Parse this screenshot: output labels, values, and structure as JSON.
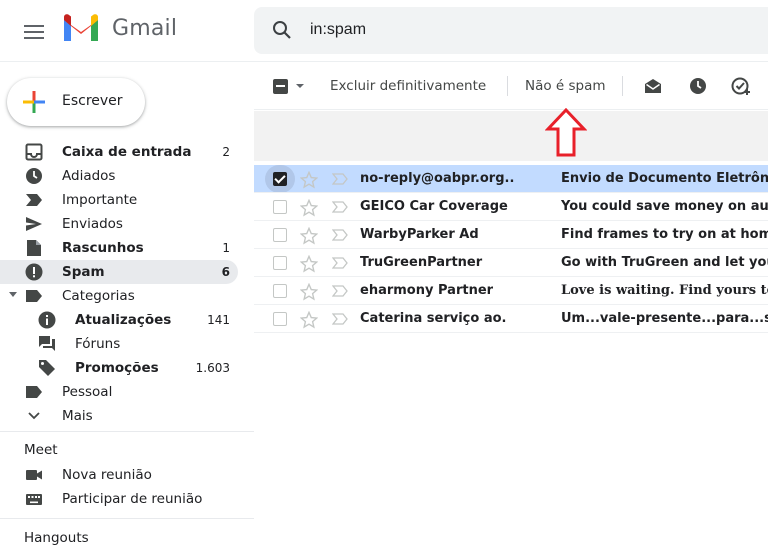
{
  "app": {
    "name": "Gmail",
    "menu_icon": "hamburger-icon",
    "logo_icon": "gmail-m-logo"
  },
  "search": {
    "value": "in:spam",
    "icon": "search-icon"
  },
  "compose": {
    "label": "Escrever",
    "icon": "plus-icon"
  },
  "sidebar": {
    "items": [
      {
        "label": "Caixa de entrada",
        "count": "2",
        "icon": "inbox-icon",
        "bold": true
      },
      {
        "label": "Adiados",
        "count": "",
        "icon": "clock-icon",
        "bold": false
      },
      {
        "label": "Importante",
        "count": "",
        "icon": "important-icon",
        "bold": false
      },
      {
        "label": "Enviados",
        "count": "",
        "icon": "send-icon",
        "bold": false
      },
      {
        "label": "Rascunhos",
        "count": "1",
        "icon": "draft-icon",
        "bold": true
      },
      {
        "label": "Spam",
        "count": "6",
        "icon": "spam-icon",
        "bold": true,
        "active": true
      },
      {
        "label": "Categorias",
        "count": "",
        "icon": "label-icon",
        "bold": false
      },
      {
        "label": "Atualizações",
        "count": "141",
        "icon": "info-icon",
        "bold": true
      },
      {
        "label": "Fóruns",
        "count": "",
        "icon": "forum-icon",
        "bold": false
      },
      {
        "label": "Promoções",
        "count": "1.603",
        "icon": "tag-icon",
        "bold": true
      },
      {
        "label": "Pessoal",
        "count": "",
        "icon": "label-icon",
        "bold": false
      },
      {
        "label": "Mais",
        "count": "",
        "icon": "chevron-down-icon",
        "bold": false
      }
    ]
  },
  "meet": {
    "title": "Meet",
    "items": [
      {
        "label": "Nova reunião",
        "icon": "video-icon"
      },
      {
        "label": "Participar de reunião",
        "icon": "keyboard-icon"
      }
    ]
  },
  "hangouts": {
    "title": "Hangouts"
  },
  "toolbar": {
    "delete_forever": "Excluir definitivamente",
    "not_spam": "Não é spam",
    "icons": [
      "mark-read-icon",
      "snooze-icon",
      "add-task-icon"
    ]
  },
  "emails": [
    {
      "sender": "no-reply@oabpr.org..",
      "subject": "Envio de Documento Eletrônico",
      "selected": true
    },
    {
      "sender": "GEICO Car Coverage",
      "subject": "You could save money on auto insurance",
      "selected": false
    },
    {
      "sender": "WarbyParker Ad",
      "subject": "Find frames to try on at home for free",
      "selected": false
    },
    {
      "sender": "TruGreenPartner",
      "subject": "Go with TruGreen and let your lawn shine",
      "selected": false
    },
    {
      "sender": "eharmony Partner",
      "subject": "Love is waiting. Find yours today",
      "selected": false
    },
    {
      "sender": "Caterina serviço ao.",
      "subject": "Um...vale-presente...para...seu...aniversário",
      "selected": false
    }
  ],
  "colors": {
    "accent_red": "#ea4335",
    "selected_row": "#c2dbff",
    "annotation_arrow": "#e8202a"
  }
}
